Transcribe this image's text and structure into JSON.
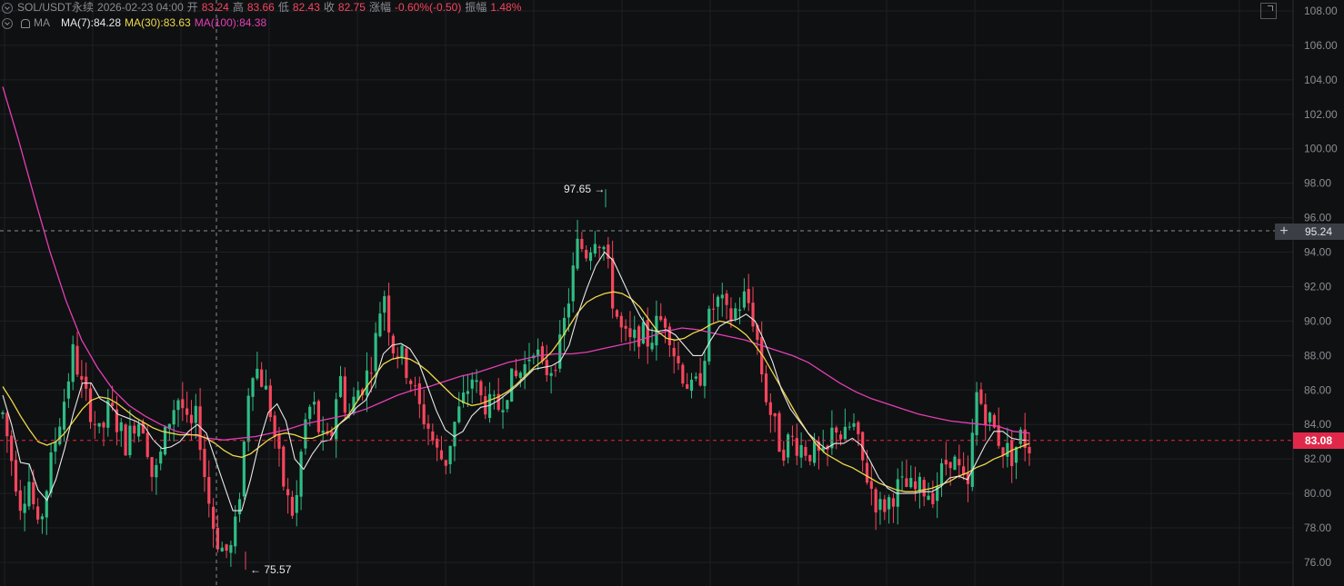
{
  "header": {
    "symbol": "SOL/USDT永续",
    "datetime": "2026-02-23 04:00",
    "open_label": "开",
    "open": "83.24",
    "high_label": "高",
    "high": "83.66",
    "low_label": "低",
    "low": "82.43",
    "close_label": "收",
    "close": "82.75",
    "change_label": "涨幅",
    "change": "-0.60%(-0.50)",
    "amp_label": "振幅",
    "amp": "1.48%",
    "indicator": "MA",
    "ma7": "MA(7):84.28",
    "ma30": "MA(30):83.63",
    "ma100": "MA(100):84.38"
  },
  "crosshair": {
    "price_label": "95.24",
    "plus": "+",
    "price": 95.24
  },
  "last_price": {
    "label": "83.08",
    "price": 83.08
  },
  "extremes": {
    "high_label": "97.65 →",
    "low_label": "← 75.57",
    "high": 97.65,
    "low": 75.57
  },
  "colors": {
    "up": "#2ebd85",
    "down": "#f6465d",
    "ma7": "#e8e8e8",
    "ma30": "#f0d84a",
    "ma100": "#e33fb4",
    "grid": "#1e2024",
    "axis_text": "#8b8d93"
  },
  "chart_data": {
    "type": "candlestick",
    "symbol": "SOL/USDT",
    "ylim": [
      75,
      109
    ],
    "yticks": [
      "76.00",
      "78.00",
      "80.00",
      "82.00",
      "84.00",
      "86.00",
      "88.00",
      "90.00",
      "92.00",
      "94.00",
      "96.00",
      "98.00",
      "100.00",
      "102.00",
      "104.00",
      "106.00",
      "108.00"
    ],
    "candles_approx": 235,
    "path_close": [
      84.6,
      82.0,
      79.5,
      80.8,
      77.6,
      80.5,
      83.3,
      85.6,
      88.3,
      86.0,
      84.8,
      83.2,
      85.0,
      84.0,
      82.8,
      84.4,
      84.0,
      80.6,
      82.5,
      84.7,
      85.7,
      83.4,
      84.5,
      80.3,
      77.6,
      76.6,
      76.8,
      81.2,
      87.6,
      87.0,
      85.5,
      82.5,
      79.8,
      78.6,
      83.8,
      85.4,
      83.0,
      82.8,
      87.1,
      84.3,
      85.9,
      86.6,
      88.4,
      92.1,
      88.6,
      88.0,
      86.8,
      85.0,
      84.0,
      82.4,
      81.8,
      84.0,
      85.3,
      86.8,
      85.5,
      85.0,
      85.0,
      86.2,
      86.7,
      87.4,
      88.8,
      87.0,
      87.4,
      88.5,
      91.5,
      94.5,
      94.0,
      95.2,
      94.2,
      91.0,
      89.2,
      88.6,
      89.4,
      88.8,
      89.9,
      90.2,
      87.9,
      86.8,
      85.7,
      87.2,
      90.7,
      91.2,
      90.0,
      90.8,
      91.5,
      89.8,
      86.2,
      84.2,
      82.5,
      83.2,
      82.8,
      82.5,
      82.2,
      81.8,
      84.2,
      83.0,
      84.2,
      82.0,
      80.5,
      79.1,
      79.5,
      80.3,
      80.4,
      80.1,
      80.3,
      80.0,
      81.1,
      82.3,
      81.3,
      79.8,
      85.8,
      84.8,
      83.7,
      82.7,
      82.2,
      83.3,
      82.75
    ],
    "ma7_path": [
      85.7,
      84.0,
      81.8,
      81.7,
      80.2,
      79.6,
      80.8,
      82.6,
      84.7,
      86.4,
      86.4,
      85.5,
      85.2,
      84.6,
      84.4,
      84.2,
      83.9,
      83.1,
      82.6,
      82.7,
      83.0,
      83.6,
      84.0,
      83.5,
      82.0,
      80.5,
      79.0,
      79.0,
      80.8,
      83.0,
      84.7,
      85.2,
      84.2,
      82.0,
      81.4,
      82.3,
      83.0,
      83.1,
      84.0,
      84.4,
      85.0,
      85.4,
      86.4,
      88.1,
      88.6,
      88.7,
      88.4,
      87.6,
      86.2,
      84.8,
      83.7,
      83.3,
      83.6,
      84.5,
      85.0,
      85.1,
      85.4,
      85.8,
      86.2,
      86.7,
      87.2,
      87.3,
      87.4,
      87.7,
      88.6,
      90.4,
      91.9,
      93.2,
      94.0,
      93.5,
      92.4,
      91.3,
      90.3,
      89.5,
      89.4,
      89.5,
      89.2,
      88.6,
      88.0,
      88.0,
      88.9,
      89.7,
      90.0,
      90.1,
      90.4,
      90.0,
      88.9,
      87.6,
      86.0,
      84.9,
      84.2,
      83.5,
      83.0,
      82.6,
      82.9,
      82.9,
      83.2,
      82.8,
      81.9,
      80.9,
      80.3,
      80.0,
      80.0,
      80.0,
      80.1,
      80.1,
      80.4,
      80.9,
      81.0,
      80.8,
      81.8,
      82.8,
      83.6,
      83.6,
      83.2,
      83.1,
      83.08
    ],
    "ma30_path": [
      86.2,
      85.4,
      84.5,
      83.7,
      83.0,
      82.8,
      83.0,
      83.5,
      84.2,
      84.9,
      85.4,
      85.6,
      85.5,
      85.2,
      84.8,
      84.4,
      84.1,
      83.8,
      83.6,
      83.5,
      83.4,
      83.4,
      83.4,
      83.2,
      82.9,
      82.5,
      82.2,
      82.1,
      82.3,
      82.7,
      83.1,
      83.4,
      83.5,
      83.4,
      83.2,
      83.2,
      83.4,
      83.6,
      84.0,
      84.5,
      85.3,
      86.1,
      86.8,
      87.5,
      87.8,
      87.9,
      87.8,
      87.5,
      87.1,
      86.6,
      86.1,
      85.6,
      85.3,
      85.1,
      85.2,
      85.4,
      85.6,
      85.9,
      86.3,
      86.8,
      87.3,
      87.7,
      88.2,
      88.9,
      89.7,
      90.5,
      91.1,
      91.4,
      91.6,
      91.7,
      91.6,
      91.3,
      90.8,
      90.1,
      89.4,
      89.0,
      88.9,
      89.0,
      89.3,
      89.5,
      89.8,
      90.0,
      89.9,
      89.6,
      89.2,
      88.6,
      87.9,
      87.0,
      86.1,
      85.2,
      84.3,
      83.5,
      82.8,
      82.3,
      82.0,
      81.7,
      81.5,
      81.2,
      80.9,
      80.6,
      80.4,
      80.2,
      80.1,
      80.1,
      80.2,
      80.3,
      80.5,
      80.7,
      81.0,
      81.2,
      81.5,
      81.7,
      82.0,
      82.2,
      82.5,
      82.7,
      82.9
    ],
    "ma100_path": [
      103.6,
      100.5,
      97.2,
      94.0,
      91.2,
      88.9,
      87.3,
      86.0,
      85.1,
      84.5,
      84.0,
      83.6,
      83.4,
      83.2,
      83.1,
      83.2,
      83.3,
      83.5,
      83.7,
      84.0,
      84.2,
      84.4,
      84.6,
      84.9,
      85.3,
      85.7,
      86.0,
      86.2,
      86.5,
      86.8,
      87.0,
      87.3,
      87.6,
      87.8,
      88.0,
      88.1,
      88.1,
      88.2,
      88.4,
      88.6,
      88.8,
      89.1,
      89.4,
      89.6,
      89.5,
      89.3,
      89.1,
      88.9,
      88.6,
      88.3,
      88.0,
      87.6,
      87.0,
      86.4,
      85.9,
      85.5,
      85.2,
      84.9,
      84.6,
      84.4,
      84.2,
      84.1,
      84.0,
      83.9,
      83.6,
      83.5
    ],
    "xlabel": "",
    "ylabel": "",
    "grid": true
  }
}
